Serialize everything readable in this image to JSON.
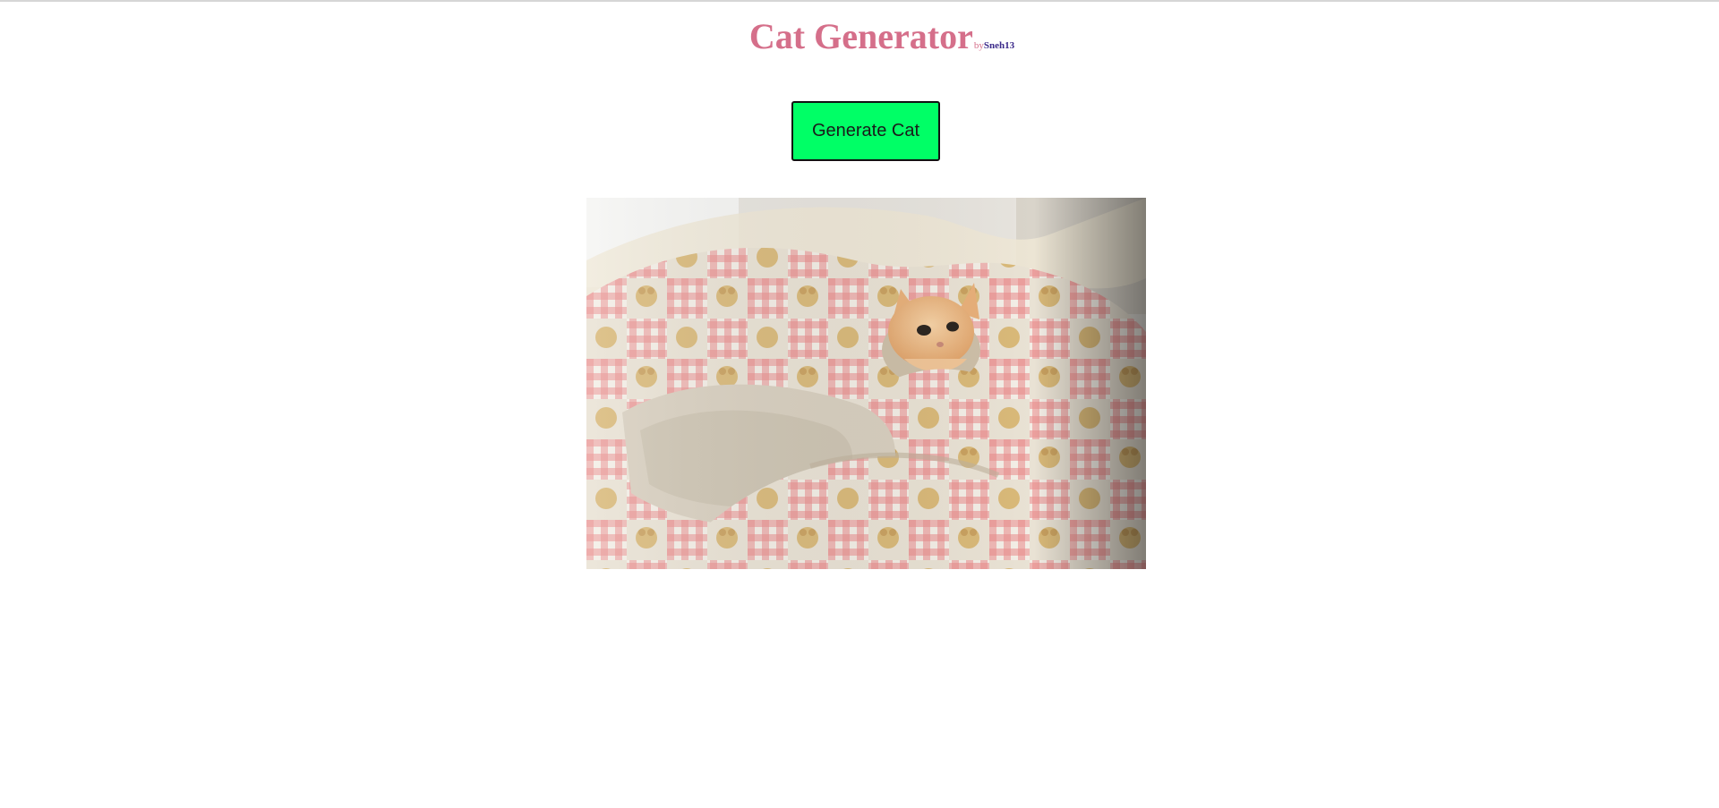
{
  "header": {
    "title": "Cat Generator",
    "by_word": "by",
    "author": "Sneh13"
  },
  "actions": {
    "generate_label": "Generate Cat"
  },
  "image": {
    "alt": "kitten",
    "subject": "kitten peeking out from a quilted blanket"
  },
  "colors": {
    "title": "#d56f8a",
    "author": "#3b2a8a",
    "button": "#00ff66",
    "button_border": "#111111"
  }
}
